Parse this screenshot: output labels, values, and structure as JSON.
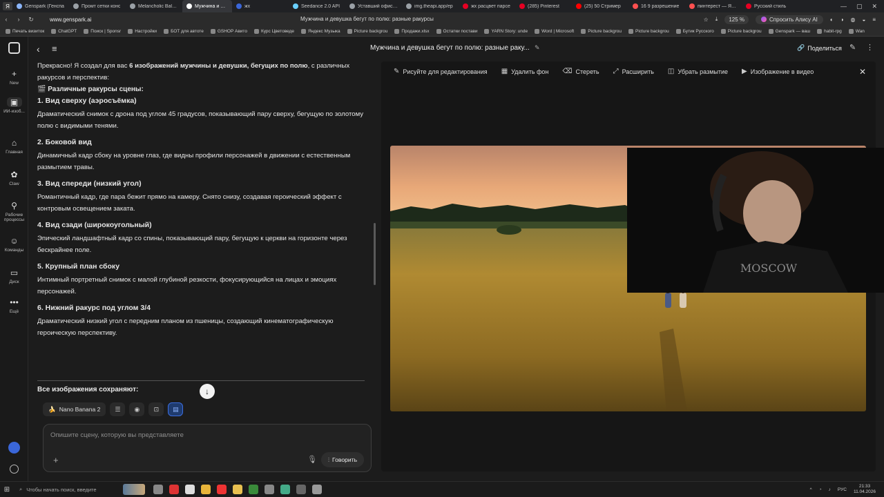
{
  "browser": {
    "tabs": [
      {
        "label": "Genspark (Генспа",
        "color": "#8ab4f8"
      },
      {
        "label": "Промт сетки конс",
        "color": "#9aa0a6"
      },
      {
        "label": "Melancholic Bald C",
        "color": "#9aa0a6"
      },
      {
        "label": "Мужчина и дев",
        "color": "#ffffff",
        "active": true
      },
      {
        "label": "жх",
        "color": "#3a66d8"
      },
      {
        "label": "Seedance 2.0 API",
        "color": "#6ad0ff"
      },
      {
        "label": "Уставший офисны",
        "color": "#9aa0a6"
      },
      {
        "label": "img.theapi.app/ep",
        "color": "#9aa0a6"
      },
      {
        "label": "жх расцвет парсе",
        "color": "#e60023"
      },
      {
        "label": "(285) Pinterest",
        "color": "#e60023"
      },
      {
        "label": "(25) 50 Стример",
        "color": "#ff0000"
      },
      {
        "label": "16 9 разрешение",
        "color": "#ff5050"
      },
      {
        "label": "пинтерест — Янде",
        "color": "#ff5050"
      },
      {
        "label": "Русский стиль",
        "color": "#e60023"
      }
    ],
    "url": "www.genspark.ai",
    "page_title": "Мужчина и девушка бегут по полю: разные ракурсы",
    "zoom": "125 %",
    "alice": "Спросить Алису AI",
    "bookmarks": [
      "Печать визиток",
      "ChatGPT",
      "Поиск | Sponsr",
      "Настройки",
      "БОТ для автоте",
      "GSHOP Авито",
      "Курс Цветоведе",
      "Яндекс Музыка",
      "Picture backgrou",
      "Продажи.xlsx",
      "Остатки постави",
      "YARN Story: unde",
      "Word | Microsoft",
      "Picture backgrou",
      "Picture backgrou",
      "Бутик Русского",
      "Picture backgrou",
      "Genspark — ваш",
      "habit-rpg",
      "Wan"
    ]
  },
  "sidebar": {
    "items": [
      {
        "label": "New",
        "icon": "+"
      },
      {
        "label": "ИИ-изоб...",
        "icon": "▣",
        "active": true
      },
      {
        "label": "Главная",
        "icon": "⌂"
      },
      {
        "label": "Claw",
        "icon": "✿"
      },
      {
        "label": "Рабочие процессы",
        "icon": "⚲"
      },
      {
        "label": "Команды",
        "icon": "☺"
      },
      {
        "label": "Диск",
        "icon": "▭"
      },
      {
        "label": "Ещё",
        "icon": "•••"
      }
    ]
  },
  "chat": {
    "intro_prefix": "Прекрасно! Я создал для вас ",
    "intro_bold": "6 изображений мужчины и девушки, бегущих по полю",
    "intro_suffix": ", с различных ракурсов и перспектив:",
    "section_title": "🎬 Различные ракурсы сцены:",
    "angles": [
      {
        "title": "1. Вид сверху (аэросъёмка)",
        "desc": "Драматический снимок с дрона под углом 45 градусов, показывающий пару сверху, бегущую по золотому полю с видимыми тенями."
      },
      {
        "title": "2. Боковой вид",
        "desc": "Динамичный кадр сбоку на уровне глаз, где видны профили персонажей в движении с естественным размытием травы."
      },
      {
        "title": "3. Вид спереди (низкий угол)",
        "desc": "Романтичный кадр, где пара бежит прямо на камеру. Снято снизу, создавая героический эффект с контровым освещением заката."
      },
      {
        "title": "4. Вид сзади (широкоугольный)",
        "desc": "Эпический ландшафтный кадр со спины, показывающий пару, бегущую к церкви на горизонте через бескрайнее поле."
      },
      {
        "title": "5. Крупный план сбоку",
        "desc": "Интимный портретный снимок с малой глубиной резкости, фокусирующийся на лицах и эмоциях персонажей."
      },
      {
        "title": "6. Нижний ракурс под углом 3/4",
        "desc": "Драматический низкий угол с передним планом из пшеницы, создающий кинематографическую героическую перспективу."
      }
    ],
    "keeps_label": "Все изображения сохраняют:",
    "model_chip": "Nano Banana 2",
    "input_placeholder": "Опишите сцену, которую вы представляете",
    "speak_label": "Говорить"
  },
  "viewer": {
    "title": "Мужчина и девушка бегут по полю: разные раку...",
    "share": "Поделиться",
    "tools": [
      {
        "label": "Рисуйте для редактирования",
        "icon": "✎"
      },
      {
        "label": "Удалить фон",
        "icon": "▦"
      },
      {
        "label": "Стереть",
        "icon": "⌫"
      },
      {
        "label": "Расширить",
        "icon": "⤢"
      },
      {
        "label": "Убрать размытие",
        "icon": "◫"
      },
      {
        "label": "Изображение в видео",
        "icon": "▶"
      }
    ]
  },
  "webcam": {
    "shirt_text": "MOSCOW"
  },
  "taskbar": {
    "search_placeholder": "Чтобы начать поиск, введите",
    "lang": "РУС",
    "time": "21:33",
    "date": "11.04.2026"
  },
  "colors": {
    "accent": "#3a66d8",
    "background": "#1c1c1c",
    "sky_top": "#c98a6a",
    "sky_bottom": "#f0b480",
    "field": "#a07a28"
  }
}
